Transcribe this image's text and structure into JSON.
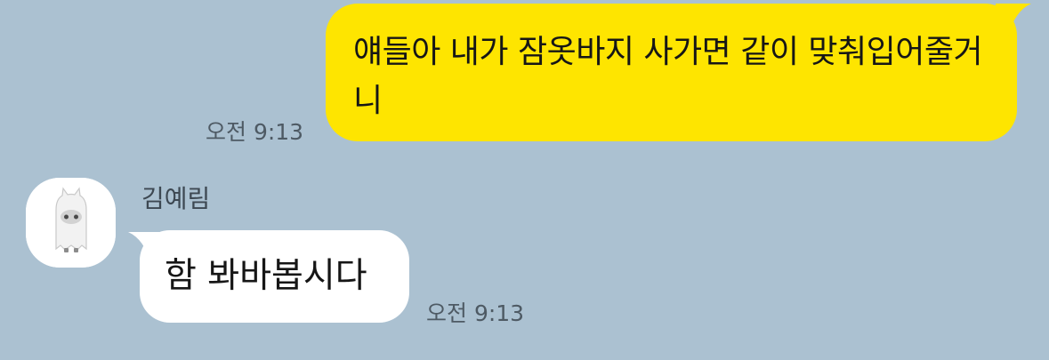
{
  "messages": {
    "outgoing": {
      "text": "얘들아 내가 잠옷바지 사가면 같이 맞춰입어줄거니",
      "time": "오전 9:13"
    },
    "incoming": {
      "sender": "김예림",
      "text": "함 봐바봅시다",
      "time": "오전 9:13",
      "avatar_icon": "ghost-avatar-icon"
    }
  },
  "colors": {
    "background": "#abc1d1",
    "outgoing_bubble": "#fee500",
    "incoming_bubble": "#ffffff",
    "timestamp": "#4e5a64"
  }
}
